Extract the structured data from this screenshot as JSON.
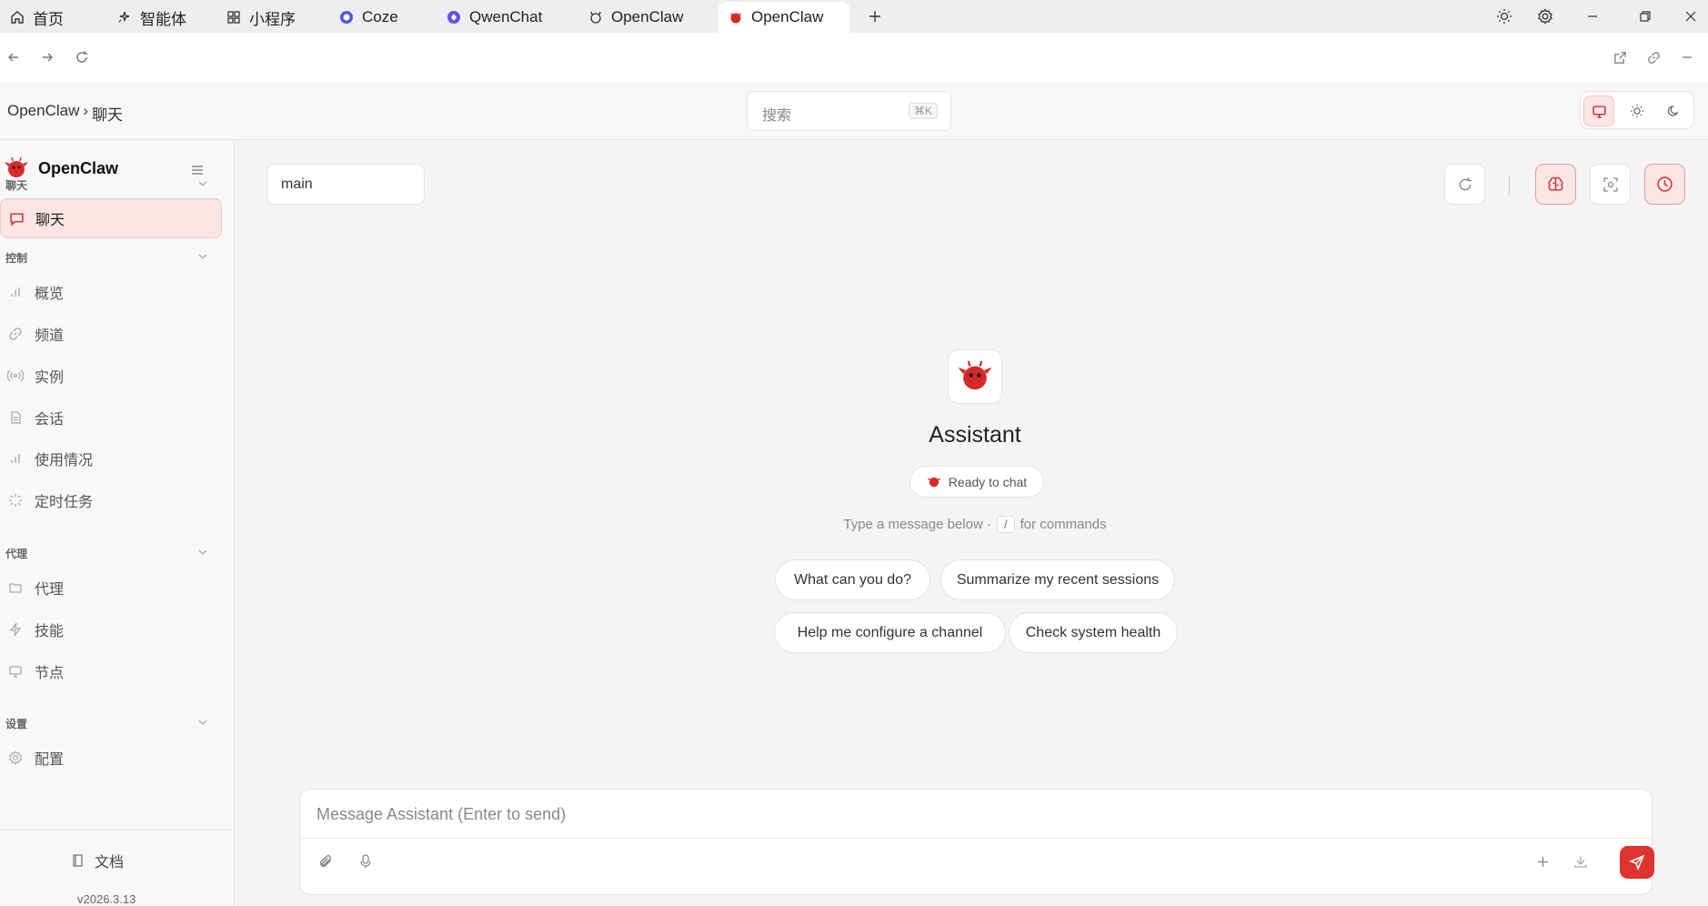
{
  "browser": {
    "tabs": [
      {
        "label": "首页",
        "icon": "home-icon"
      },
      {
        "label": "智能体",
        "icon": "sparkle-icon"
      },
      {
        "label": "小程序",
        "icon": "grid-icon"
      },
      {
        "label": "Coze",
        "icon": "coze-icon"
      },
      {
        "label": "QwenChat",
        "icon": "qwen-icon"
      },
      {
        "label": "OpenClaw",
        "icon": "claw-outline-icon"
      },
      {
        "label": "OpenClaw",
        "icon": "claw-red-icon"
      }
    ]
  },
  "header": {
    "breadcrumb_app": "OpenClaw",
    "breadcrumb_sep": "›",
    "breadcrumb_page": "聊天",
    "search_placeholder": "搜索",
    "search_shortcut": "⌘K"
  },
  "sidebar": {
    "app_name": "OpenClaw",
    "groups": [
      {
        "title": "聊天",
        "items": [
          {
            "label": "聊天",
            "icon": "chat-icon",
            "active": true
          }
        ]
      },
      {
        "title": "控制",
        "items": [
          {
            "label": "概览",
            "icon": "bar-chart-icon"
          },
          {
            "label": "频道",
            "icon": "link-icon"
          },
          {
            "label": "实例",
            "icon": "radio-icon"
          },
          {
            "label": "会话",
            "icon": "file-icon"
          },
          {
            "label": "使用情况",
            "icon": "bar-chart-icon"
          },
          {
            "label": "定时任务",
            "icon": "loader-icon"
          }
        ]
      },
      {
        "title": "代理",
        "items": [
          {
            "label": "代理",
            "icon": "folder-icon"
          },
          {
            "label": "技能",
            "icon": "bolt-icon"
          },
          {
            "label": "节点",
            "icon": "monitor-icon"
          }
        ]
      },
      {
        "title": "设置",
        "items": [
          {
            "label": "配置",
            "icon": "gear-icon"
          }
        ]
      }
    ],
    "docs_label": "文档",
    "version": "v2026.3.13"
  },
  "main": {
    "session": "main",
    "assistant_name": "Assistant",
    "status": "Ready to chat",
    "hint_before": "Type a message below ·",
    "hint_key": "/",
    "hint_after": "for commands",
    "suggestions": [
      "What can you do?",
      "Summarize my recent sessions",
      "Help me configure a channel",
      "Check system health"
    ],
    "composer_placeholder": "Message Assistant (Enter to send)"
  },
  "colors": {
    "accent": "#e0332f",
    "accent_bg": "#fbe6e6"
  }
}
